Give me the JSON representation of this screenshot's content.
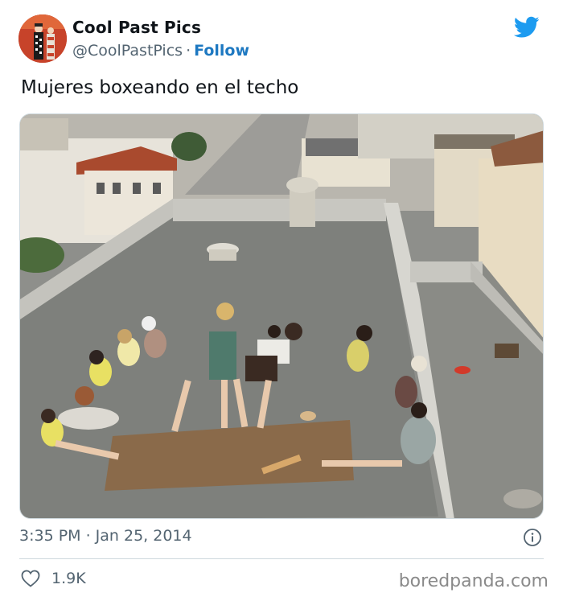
{
  "author": {
    "display_name": "Cool Past Pics",
    "handle": "@CoolPastPics",
    "separator": "·",
    "follow_label": "Follow"
  },
  "tweet": {
    "text": "Mujeres boxeando en el techo",
    "timestamp": "3:35 PM · Jan 25, 2014",
    "likes": "1.9K"
  },
  "icons": {
    "platform": "twitter-bird-icon",
    "info": "info-icon",
    "like": "heart-icon"
  },
  "footer": {
    "source": "boredpanda.com"
  },
  "colors": {
    "follow": "#1d78c1",
    "bird": "#1d9bf0",
    "muted": "#536471"
  }
}
